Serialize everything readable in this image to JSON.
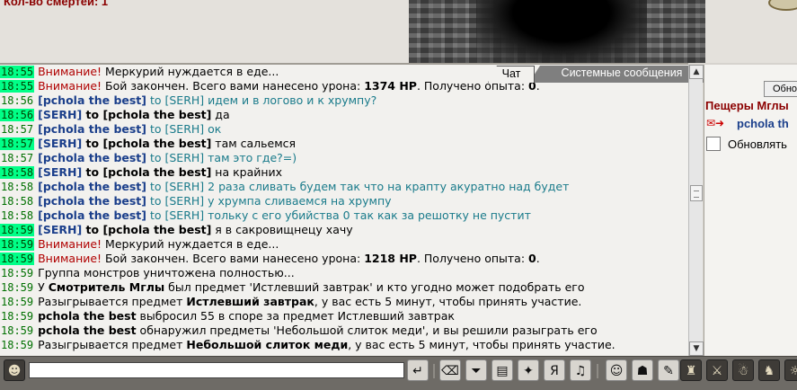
{
  "header": {
    "deaths_label": "Кол-во смертей: 1"
  },
  "tabs": [
    {
      "label": "Чат"
    },
    {
      "label": "Системные сообщения"
    }
  ],
  "messages": [
    {
      "time": "18:55",
      "hl": true,
      "parts": [
        {
          "t": "sys",
          "v": "Внимание!"
        },
        {
          "t": "plain",
          "v": " Меркурий нуждается в еде..."
        }
      ]
    },
    {
      "time": "18:55",
      "hl": true,
      "parts": [
        {
          "t": "sys",
          "v": "Внимание!"
        },
        {
          "t": "plain",
          "v": " Бой закончен. Всего вами нанесено урона: "
        },
        {
          "t": "bold",
          "v": "1374 HP"
        },
        {
          "t": "plain",
          "v": ". Получено опыта: "
        },
        {
          "t": "bold",
          "v": "0"
        },
        {
          "t": "plain",
          "v": "."
        }
      ]
    },
    {
      "time": "18:56",
      "hl": false,
      "parts": [
        {
          "t": "nick",
          "v": "[pchola the best]"
        },
        {
          "t": "teal",
          "v": " to [SERH] идем и в логово и к хрумпу?"
        }
      ]
    },
    {
      "time": "18:56",
      "hl": true,
      "parts": [
        {
          "t": "nick",
          "v": "[SERH]"
        },
        {
          "t": "pnick",
          "v": " to [pchola the best]"
        },
        {
          "t": "plain",
          "v": " да"
        }
      ]
    },
    {
      "time": "18:57",
      "hl": false,
      "parts": [
        {
          "t": "nick",
          "v": "[pchola the best]"
        },
        {
          "t": "teal",
          "v": " to [SERH] ок"
        }
      ]
    },
    {
      "time": "18:57",
      "hl": true,
      "parts": [
        {
          "t": "nick",
          "v": "[SERH]"
        },
        {
          "t": "pnick",
          "v": " to [pchola the best]"
        },
        {
          "t": "plain",
          "v": " там сальемся"
        }
      ]
    },
    {
      "time": "18:57",
      "hl": false,
      "parts": [
        {
          "t": "nick",
          "v": "[pchola the best]"
        },
        {
          "t": "teal",
          "v": " to [SERH] там это где?=)"
        }
      ]
    },
    {
      "time": "18:58",
      "hl": true,
      "parts": [
        {
          "t": "nick",
          "v": "[SERH]"
        },
        {
          "t": "pnick",
          "v": " to [pchola the best]"
        },
        {
          "t": "plain",
          "v": " на крайних"
        }
      ]
    },
    {
      "time": "18:58",
      "hl": false,
      "parts": [
        {
          "t": "nick",
          "v": "[pchola the best]"
        },
        {
          "t": "teal",
          "v": " to [SERH] 2 раза сливать будем так что на крапту акуратно над будет"
        }
      ]
    },
    {
      "time": "18:58",
      "hl": false,
      "parts": [
        {
          "t": "nick",
          "v": "[pchola the best]"
        },
        {
          "t": "teal",
          "v": " to [SERH] у хрумпа сливаемся на хрумпу"
        }
      ]
    },
    {
      "time": "18:58",
      "hl": false,
      "parts": [
        {
          "t": "nick",
          "v": "[pchola the best]"
        },
        {
          "t": "teal",
          "v": " to [SERH] тольку с его убийства 0 так как за решотку не пустит"
        }
      ]
    },
    {
      "time": "18:59",
      "hl": true,
      "parts": [
        {
          "t": "nick",
          "v": "[SERH]"
        },
        {
          "t": "pnick",
          "v": " to [pchola the best]"
        },
        {
          "t": "plain",
          "v": " я в сакровищнецу хачу"
        }
      ]
    },
    {
      "time": "18:59",
      "hl": true,
      "parts": [
        {
          "t": "sys",
          "v": "Внимание!"
        },
        {
          "t": "plain",
          "v": " Меркурий нуждается в еде..."
        }
      ]
    },
    {
      "time": "18:59",
      "hl": true,
      "parts": [
        {
          "t": "sys",
          "v": "Внимание!"
        },
        {
          "t": "plain",
          "v": " Бой закончен. Всего вами нанесено урона: "
        },
        {
          "t": "bold",
          "v": "1218 HP"
        },
        {
          "t": "plain",
          "v": ". Получено опыта: "
        },
        {
          "t": "bold",
          "v": "0"
        },
        {
          "t": "plain",
          "v": "."
        }
      ]
    },
    {
      "time": "18:59",
      "hl": false,
      "parts": [
        {
          "t": "plain",
          "v": "Группа монстров уничтожена полностью..."
        }
      ]
    },
    {
      "time": "18:59",
      "hl": false,
      "parts": [
        {
          "t": "plain",
          "v": "У "
        },
        {
          "t": "bold",
          "v": "Смотритель Мглы"
        },
        {
          "t": "plain",
          "v": " был предмет 'Истлевший завтрак' и кто угодно может подобрать его"
        }
      ]
    },
    {
      "time": "18:59",
      "hl": false,
      "parts": [
        {
          "t": "plain",
          "v": "Разыгрывается предмет "
        },
        {
          "t": "bold",
          "v": "Истлевший завтрак"
        },
        {
          "t": "plain",
          "v": ", у вас есть 5 минут, чтобы принять участие."
        }
      ]
    },
    {
      "time": "18:59",
      "hl": false,
      "parts": [
        {
          "t": "bold",
          "v": "pchola the best"
        },
        {
          "t": "plain",
          "v": " выбросил 55 в споре за предмет Истлевший завтрак"
        }
      ]
    },
    {
      "time": "18:59",
      "hl": false,
      "parts": [
        {
          "t": "bold",
          "v": "pchola the best"
        },
        {
          "t": "plain",
          "v": " обнаружил предметы 'Небольшой слиток меди', и вы решили разыграть его"
        }
      ]
    },
    {
      "time": "18:59",
      "hl": false,
      "parts": [
        {
          "t": "plain",
          "v": "Разыгрывается предмет "
        },
        {
          "t": "bold",
          "v": "Небольшой слиток меди"
        },
        {
          "t": "plain",
          "v": ", у вас есть 5 минут, чтобы принять участие."
        }
      ]
    }
  ],
  "right_panel": {
    "refresh_button": "Обно",
    "location": "Пещеры Мглы",
    "user": "pchola th",
    "refresh_checkbox_label": "Обновлять"
  },
  "input": {
    "value": ""
  },
  "icons": [
    "smiley-icon",
    "enter-icon",
    "clear-icon",
    "filter-icon",
    "save-icon",
    "run-icon",
    "translit-icon",
    "sound-icon",
    "emoticon-icon",
    "group-icon",
    "marker-icon",
    "inventory-icon",
    "battle-icon",
    "helmet-icon",
    "bag-icon"
  ]
}
